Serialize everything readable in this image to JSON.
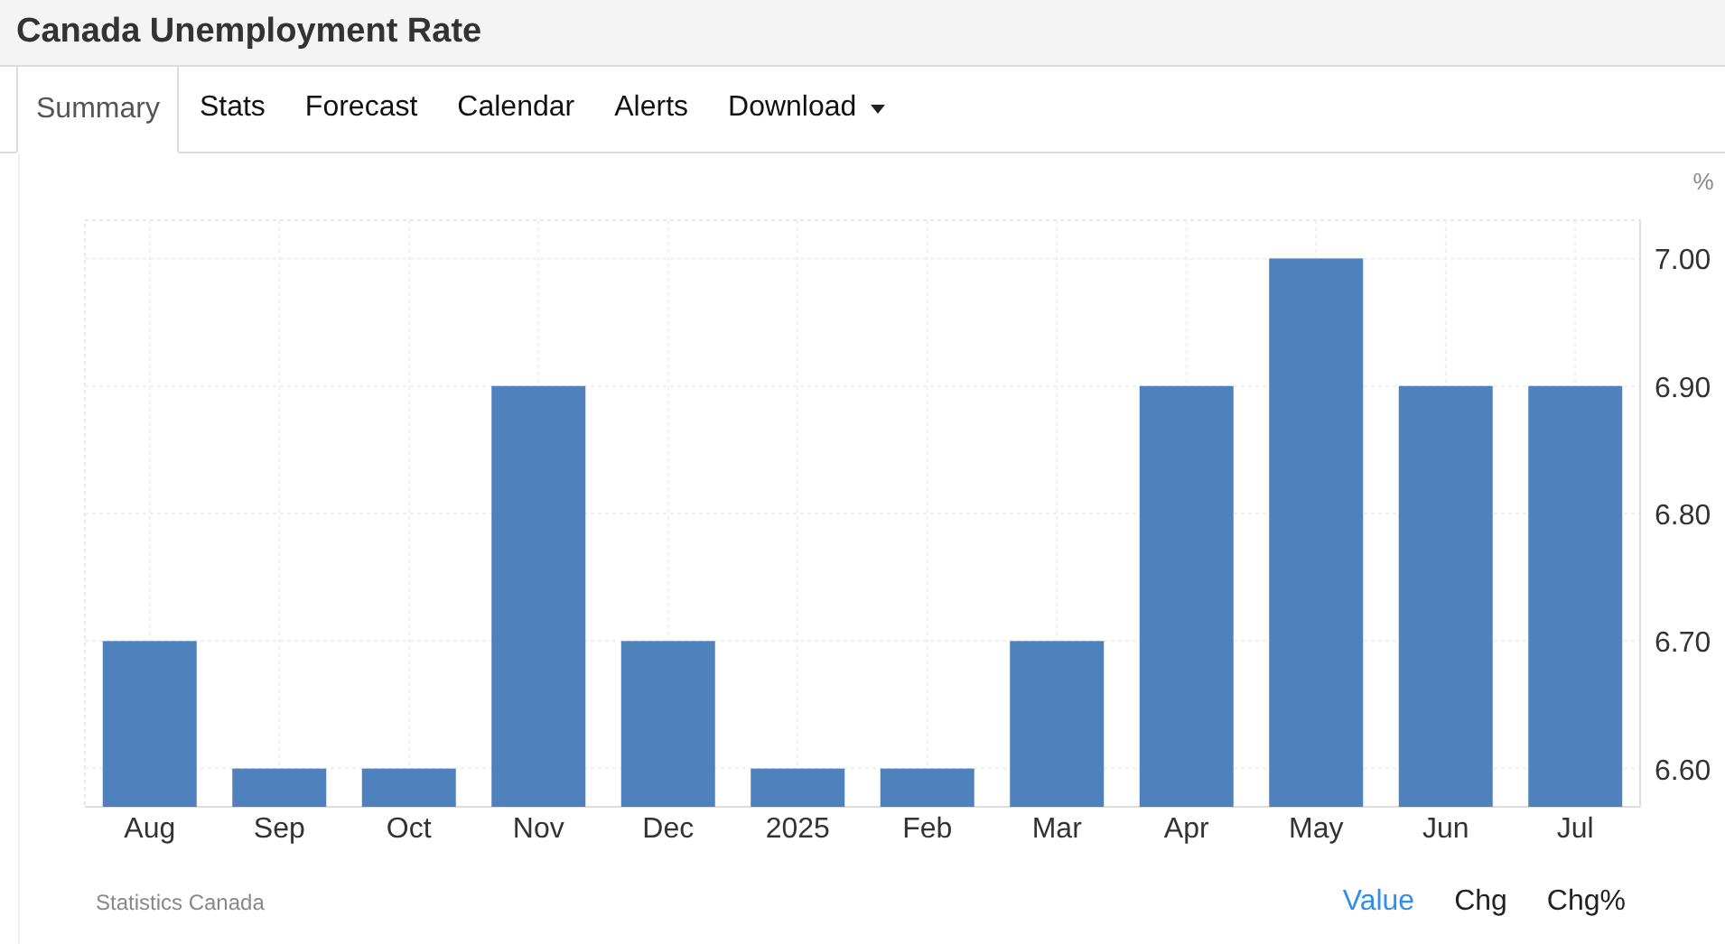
{
  "title": "Canada Unemployment Rate",
  "tabs": [
    {
      "label": "Summary",
      "selected": true,
      "kind": "tab"
    },
    {
      "label": "Stats",
      "selected": false,
      "kind": "tab"
    },
    {
      "label": "Forecast",
      "selected": false,
      "kind": "tab"
    },
    {
      "label": "Calendar",
      "selected": false,
      "kind": "tab"
    },
    {
      "label": "Alerts",
      "selected": false,
      "kind": "tab"
    },
    {
      "label": "Download",
      "selected": false,
      "kind": "dropdown"
    }
  ],
  "chart_data": {
    "type": "bar",
    "ylabel": "%",
    "categories": [
      "Aug",
      "Sep",
      "Oct",
      "Nov",
      "Dec",
      "2025",
      "Feb",
      "Mar",
      "Apr",
      "May",
      "Jun",
      "Jul"
    ],
    "grid": true,
    "series": [
      {
        "color": "#4f81bd",
        "values": [
          6.7,
          6.6,
          6.6,
          6.9,
          6.7,
          6.6,
          6.6,
          6.7,
          6.9,
          7.0,
          6.9,
          6.9
        ]
      }
    ],
    "ylim": [
      6.57,
      7.03
    ],
    "yticks": [
      {
        "value": 6.6,
        "label": "6.60"
      },
      {
        "value": 6.7,
        "label": "6.70"
      },
      {
        "value": 6.8,
        "label": "6.80"
      },
      {
        "value": 6.9,
        "label": "6.90"
      },
      {
        "value": 7.0,
        "label": "7.00"
      }
    ]
  },
  "source": "Statistics Canada",
  "view_options": [
    {
      "label": "Value",
      "selected": true
    },
    {
      "label": "Chg",
      "selected": false
    },
    {
      "label": "Chg%",
      "selected": false
    }
  ]
}
